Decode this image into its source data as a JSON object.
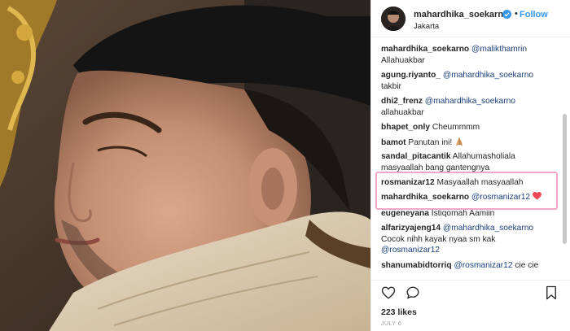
{
  "header": {
    "username": "mahardhika_soekarno",
    "separator": "•",
    "follow_label": "Follow",
    "location": "Jakarta"
  },
  "comments": [
    {
      "user": "mahardhika_soekarno",
      "mention": "@malikthamrin",
      "text": "",
      "line2": "Allahuakbar"
    },
    {
      "user": "agung.riyanto_",
      "mention": "@mahardhika_soekarno",
      "text": "",
      "line2": "takbir"
    },
    {
      "user": "dhi2_frenz",
      "mention": "@mahardhika_soekarno",
      "text": "",
      "line2": "allahuakbar"
    },
    {
      "user": "bhapet_only",
      "mention": "",
      "text": "Cheummmm",
      "line2": ""
    },
    {
      "user": "bamot",
      "mention": "",
      "text": "Panutan ini!",
      "line2": "",
      "emoji": "praying-hands"
    },
    {
      "user": "sandal_pitacantik",
      "mention": "",
      "text": "Allahumasholiala",
      "line2": "masyaallah bang gantengnya"
    },
    {
      "user": "rosmanizar12",
      "mention": "",
      "text": "Masyaallah masyaallah",
      "line2": ""
    },
    {
      "user": "mahardhika_soekarno",
      "mention": "@rosmanizar12",
      "text": "",
      "line2": "",
      "emoji": "red-heart"
    },
    {
      "user": "eugeneyana",
      "mention": "",
      "text": "Istiqomah Aamiin",
      "line2": ""
    },
    {
      "user": "alfarizyajeng14",
      "mention": "@mahardhika_soekarno",
      "text": "",
      "line2": "Cocok nihh kayak nyaa sm kak",
      "line3": "@rosmanizar12"
    },
    {
      "user": "shanumabidtorriq",
      "mention": "@rosmanizar12",
      "text": "cie cie",
      "line2": ""
    }
  ],
  "footer": {
    "likes": "223 likes",
    "date": "JULY 6"
  },
  "colors": {
    "link": "#3897f0",
    "mention": "#1b3f7a",
    "highlight": "#f4a6c6",
    "heart": "#ed4956"
  }
}
